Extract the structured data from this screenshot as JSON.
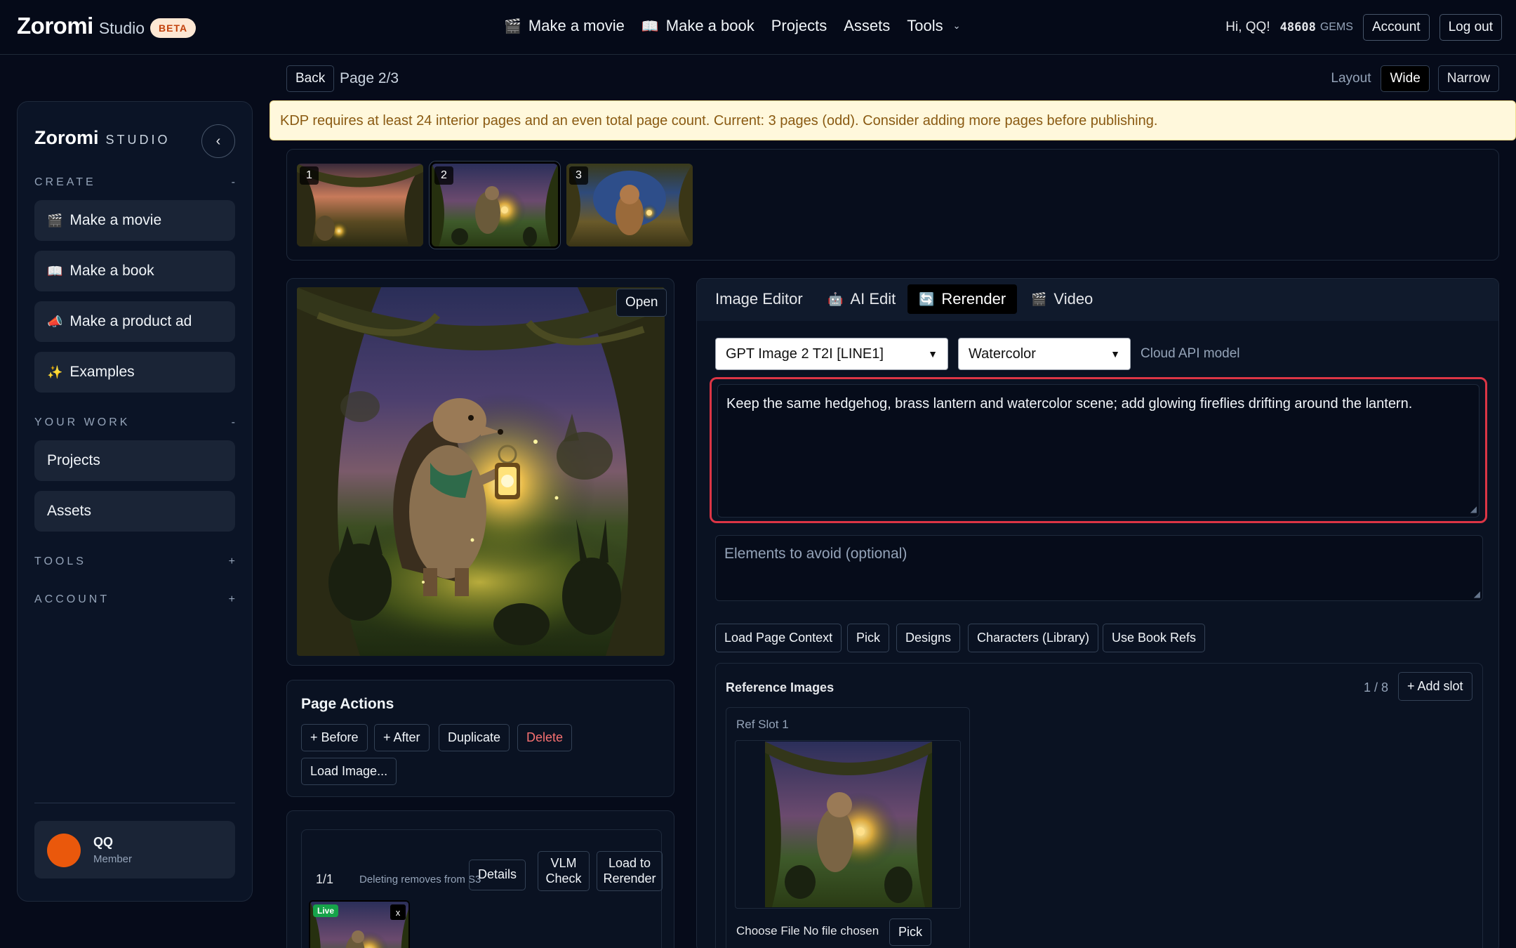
{
  "topbar": {
    "brand": "Zoromi",
    "brand_sub": "Studio",
    "badge": "BETA",
    "nav": [
      {
        "label": "Make a movie",
        "icon": "clapper-icon"
      },
      {
        "label": "Make a book",
        "icon": "book-icon"
      },
      {
        "label": "Projects"
      },
      {
        "label": "Assets"
      },
      {
        "label": "Tools"
      }
    ],
    "greeting": "Hi, QQ!",
    "gems": "48608",
    "gems_label": "GEMS",
    "account": "Account",
    "logout": "Log out"
  },
  "sidebar": {
    "brand": "Zoromi",
    "studio": "STUDIO",
    "sections": {
      "create": {
        "label": "CREATE",
        "toggle": "-"
      },
      "your_work": {
        "label": "YOUR WORK",
        "toggle": "-"
      },
      "tools": {
        "label": "TOOLS",
        "toggle": "+"
      },
      "account": {
        "label": "ACCOUNT",
        "toggle": "+"
      }
    },
    "create_items": [
      {
        "label": "Make a movie",
        "icon": "clapper-icon",
        "glyph": "🎬"
      },
      {
        "label": "Make a book",
        "icon": "book-icon",
        "glyph": "📖"
      },
      {
        "label": "Make a product ad",
        "icon": "megaphone-icon",
        "glyph": "📣"
      },
      {
        "label": "Examples",
        "icon": "sparkles-icon",
        "glyph": "✨"
      }
    ],
    "work_items": [
      {
        "label": "Projects"
      },
      {
        "label": "Assets"
      }
    ],
    "user": {
      "name": "QQ",
      "role": "Member",
      "avatar_color": "#ea580c"
    }
  },
  "page": {
    "back": "Back",
    "page_label": "Page 2/3",
    "layout_label": "Layout",
    "layout_wide": "Wide",
    "layout_narrow": "Narrow",
    "warning": "KDP requires at least 24 interior pages and an even total page count. Current: 3 pages (odd). Consider adding more pages before publishing."
  },
  "thumbnails": [
    {
      "num": "1",
      "selected": false
    },
    {
      "num": "2",
      "selected": true
    },
    {
      "num": "3",
      "selected": false
    }
  ],
  "preview": {
    "open": "Open"
  },
  "page_actions": {
    "title": "Page Actions",
    "before": "+ Before",
    "after": "+ After",
    "duplicate": "Duplicate",
    "delete": "Delete",
    "load_image": "Load Image..."
  },
  "history": {
    "count": "1/1",
    "note": "Deleting removes from S3",
    "details": "Details",
    "vlm": "VLM Check",
    "load_to_rerender": "Load to Rerender",
    "live": "Live",
    "remove": "x"
  },
  "editor": {
    "tabs": [
      {
        "label": "Image Editor",
        "icon": "",
        "active": false
      },
      {
        "label": "AI Edit",
        "icon": "robot-icon",
        "active": false
      },
      {
        "label": "Rerender",
        "icon": "refresh-icon",
        "active": true
      },
      {
        "label": "Video",
        "icon": "clapper-icon",
        "active": false
      }
    ],
    "model": "GPT Image 2 T2I [LINE1]",
    "style": "Watercolor",
    "model_hint": "Cloud API model",
    "prompt": "Keep the same hedgehog, brass lantern and watercolor scene; add glowing fireflies drifting around the lantern.",
    "avoid_placeholder": "Elements to avoid (optional)",
    "tools": [
      {
        "label": "Load Page Context"
      },
      {
        "label": "Pick"
      },
      {
        "label": "Designs"
      },
      {
        "label": "Characters (Library)"
      },
      {
        "label": "Use Book Refs"
      }
    ],
    "refs": {
      "title": "Reference Images",
      "count": "1 / 8",
      "add_slot": "+ Add slot",
      "slot_label": "Ref Slot 1",
      "choose_file": "Choose File",
      "no_file": "No file chosen",
      "pick": "Pick"
    }
  },
  "colors": {
    "background": "#060b1a",
    "highlight_border": "#dc3545",
    "warning_bg": "#fff8dc",
    "danger_text": "#f87171",
    "live_badge": "#16a34a"
  }
}
